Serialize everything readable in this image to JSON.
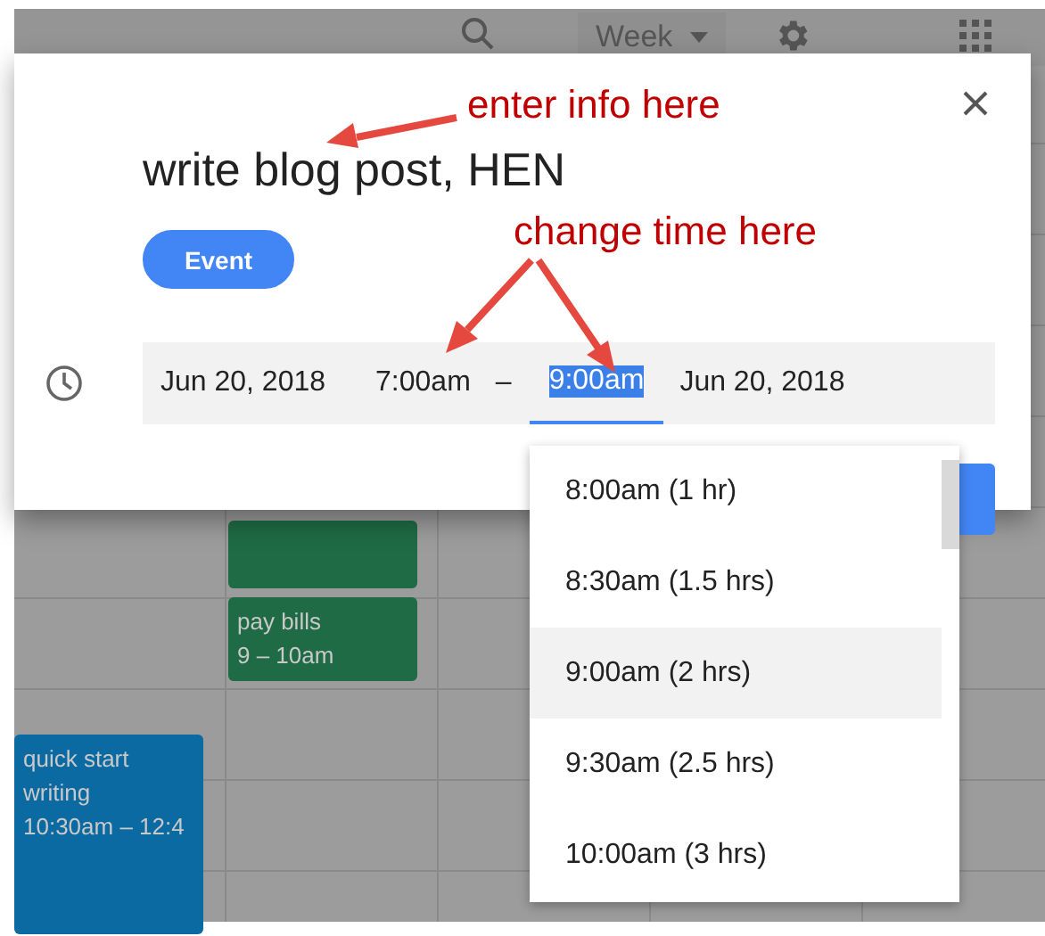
{
  "top_bar": {
    "view": "Week"
  },
  "events": [
    {
      "color": "#1e6b45"
    },
    {
      "title": "pay bills",
      "time": "9 – 10am",
      "color": "#1e6b45"
    },
    {
      "title": "quick start writing",
      "time": "10:30am – 12:4",
      "color": "#0b6aa2"
    }
  ],
  "dialog": {
    "title": "write blog post, HEN",
    "chips": [
      {
        "label": "Event",
        "selected": true
      }
    ],
    "start_date": "Jun 20, 2018",
    "start_time": "7:00am",
    "separator": "–",
    "end_time": "9:00am",
    "end_time_selected": true,
    "end_date": "Jun 20, 2018"
  },
  "dropdown": {
    "options": [
      {
        "label": "8:00am (1 hr)",
        "selected": false
      },
      {
        "label": "8:30am (1.5 hrs)",
        "selected": false
      },
      {
        "label": "9:00am (2 hrs)",
        "selected": true
      },
      {
        "label": "9:30am (2.5 hrs)",
        "selected": false
      },
      {
        "label": "10:00am (3 hrs)",
        "selected": false
      }
    ]
  },
  "annotations": [
    {
      "text": "enter info here"
    },
    {
      "text": "change time here"
    }
  ]
}
